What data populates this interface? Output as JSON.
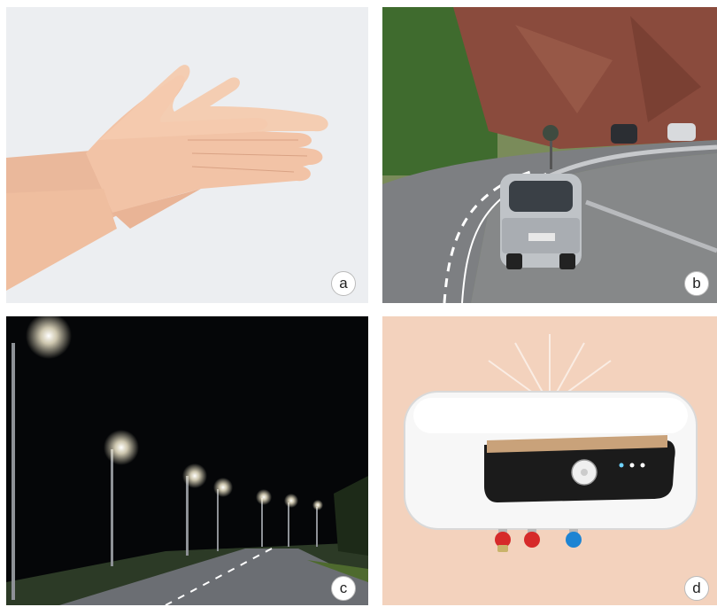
{
  "panels": [
    {
      "id": "a",
      "label": "a",
      "subject": "hands"
    },
    {
      "id": "b",
      "label": "b",
      "subject": "car-on-mountain-road"
    },
    {
      "id": "c",
      "label": "c",
      "subject": "street-lights-at-night"
    },
    {
      "id": "d",
      "label": "d",
      "subject": "electric-water-heater"
    }
  ],
  "colors": {
    "panel_a_bg": "#eceef1",
    "skin": "#f2c3a6",
    "road": "#7d7f82",
    "rock": "#8a4b3d",
    "grass": "#6f9a3c",
    "night": "#050608",
    "lamp_glow": "#fff6d8",
    "panel_d_bg": "#f3d2bd",
    "heater_body": "#f7f7f7",
    "heater_panel": "#1b1b1b",
    "valve_red": "#d62a2a",
    "valve_blue": "#1d84d3"
  }
}
